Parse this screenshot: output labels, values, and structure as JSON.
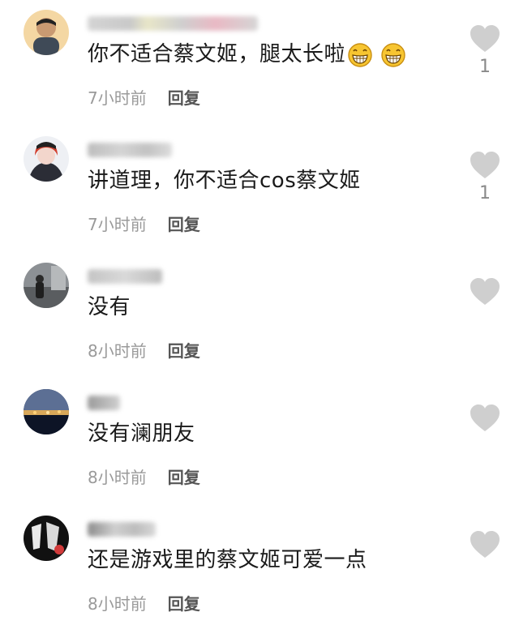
{
  "comments": [
    {
      "text": "你不适合蔡文姬，腿太长啦",
      "emoji": "grinning-face-icon",
      "time": "7小时前",
      "reply_label": "回复",
      "likes": "1"
    },
    {
      "text": "讲道理，你不适合cos蔡文姬",
      "time": "7小时前",
      "reply_label": "回复",
      "likes": "1"
    },
    {
      "text": "没有",
      "time": "8小时前",
      "reply_label": "回复",
      "likes": ""
    },
    {
      "text": "没有澜朋友",
      "time": "8小时前",
      "reply_label": "回复",
      "likes": ""
    },
    {
      "text": "还是游戏里的蔡文姬可爱一点",
      "time": "8小时前",
      "reply_label": "回复",
      "likes": ""
    }
  ],
  "colors": {
    "heart": "#cfcfcf",
    "text": "#1a1a1a",
    "time": "#9a9a9a",
    "reply": "#555555",
    "emoji_fill": "#f7c531"
  },
  "icons": {
    "like": "heart-icon",
    "emoji": "grinning-face-icon"
  }
}
